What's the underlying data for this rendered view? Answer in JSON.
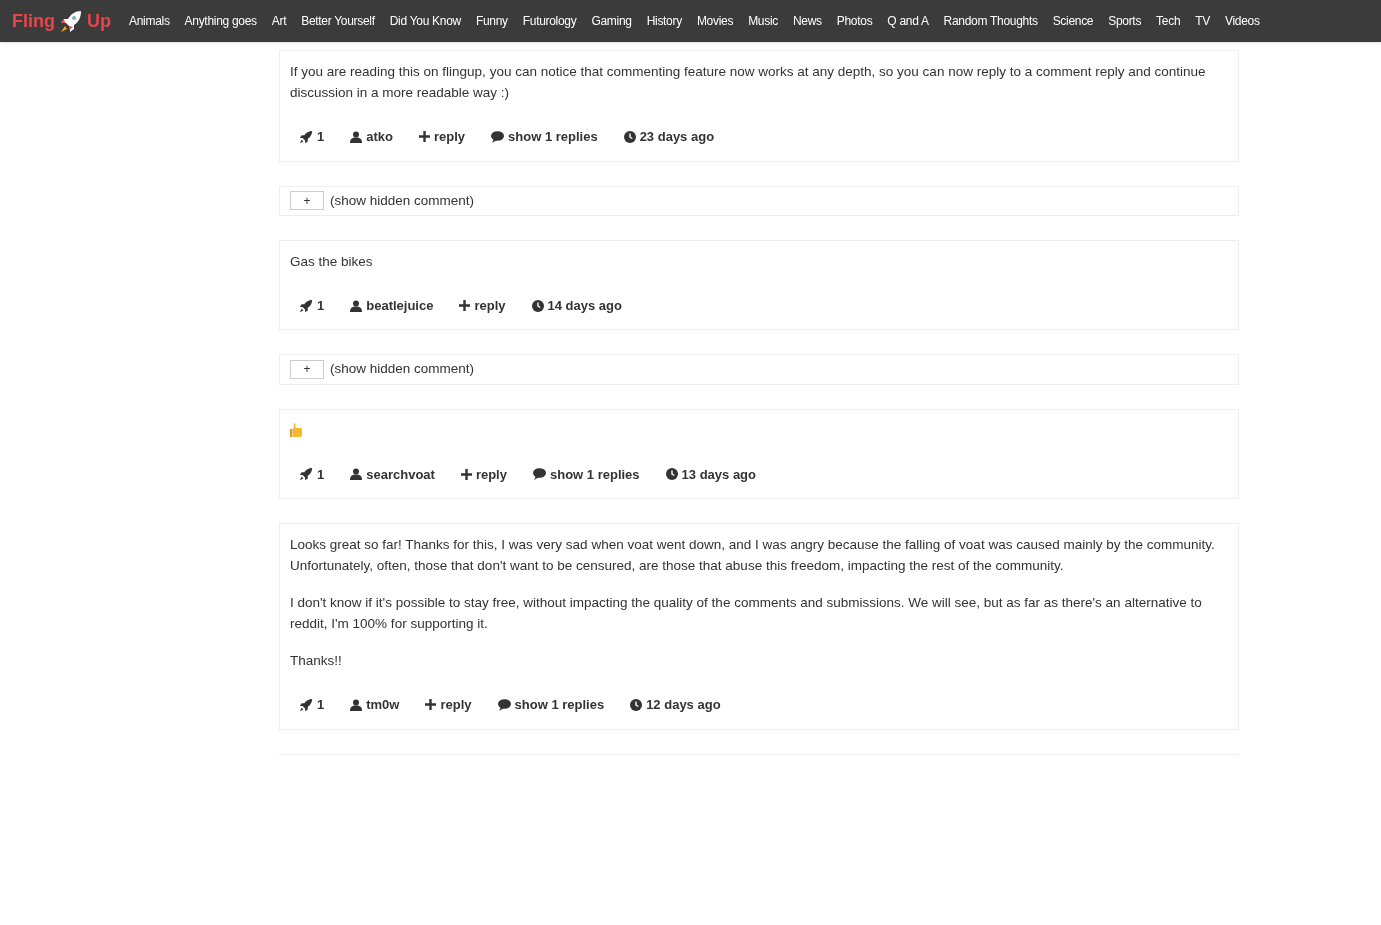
{
  "logo": {
    "left": "Fling",
    "right": "Up"
  },
  "nav": [
    "Animals",
    "Anything goes",
    "Art",
    "Better Yourself",
    "Did You Know",
    "Funny",
    "Futurology",
    "Gaming",
    "History",
    "Movies",
    "Music",
    "News",
    "Photos",
    "Q and A",
    "Random Thoughts",
    "Science",
    "Sports",
    "Tech",
    "TV",
    "Videos"
  ],
  "entries": [
    {
      "kind": "comment",
      "paragraphs": [
        "If you are reading this on flingup, you can notice that commenting feature now works at any depth, so you can now reply to a comment reply and continue discussion in a more readable way :)"
      ],
      "votes": "1",
      "author": "atko",
      "reply": "reply",
      "replies": "show 1 replies",
      "age": "23 days ago"
    },
    {
      "kind": "hidden",
      "button": "+",
      "label": "(show hidden comment)"
    },
    {
      "kind": "comment",
      "paragraphs": [
        "Gas the bikes"
      ],
      "votes": "1",
      "author": "beatlejuice",
      "reply": "reply",
      "age": "14 days ago"
    },
    {
      "kind": "hidden",
      "button": "+",
      "label": "(show hidden comment)"
    },
    {
      "kind": "emoji",
      "votes": "1",
      "author": "searchvoat",
      "reply": "reply",
      "replies": "show 1 replies",
      "age": "13 days ago"
    },
    {
      "kind": "comment",
      "paragraphs": [
        "Looks great so far! Thanks for this, I was very sad when voat went down, and I was angry because the falling of voat was caused mainly by the community. Unfortunately, often, those that don't want to be censured, are those that abuse this freedom, impacting the rest of the community.",
        "I don't know if it's possible to stay free, without impacting the quality of the comments and submissions. We will see, but as far as there's an alternative to reddit, I'm 100% for supporting it.",
        "Thanks!!"
      ],
      "votes": "1",
      "author": "tm0w",
      "reply": "reply",
      "replies": "show 1 replies",
      "age": "12 days ago"
    }
  ]
}
